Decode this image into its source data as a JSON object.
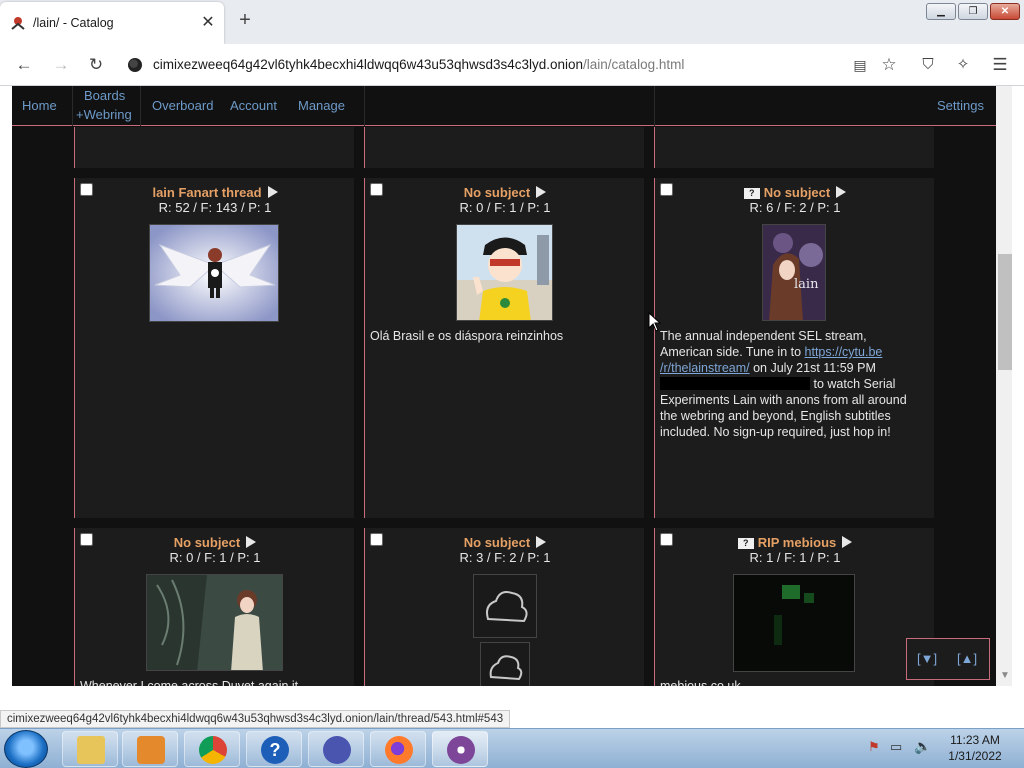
{
  "browser": {
    "tab_title": "/lain/ - Catalog",
    "tab_close": "✕",
    "new_tab": "+",
    "url_host": "cimixezweeq64g42vl6tyhk4becxhi4ldwqq6w43u53qhwsd3s4c3lyd.onion",
    "url_path": "/lain/catalog.html",
    "status_url": "cimixezweeq64g42vl6tyhk4becxhi4ldwqq6w43u53qhwsd3s4c3lyd.onion/lain/thread/543.html#543"
  },
  "site_nav": {
    "home": "Home",
    "boards": "Boards",
    "webring": "+Webring",
    "overboard": "Overboard",
    "account": "Account",
    "manage": "Manage",
    "settings": "Settings"
  },
  "threads": [
    {
      "title": "lain Fanart thread",
      "stats": "R: 52 / F: 143 / P: 1",
      "flag": ""
    },
    {
      "title": "No subject",
      "stats": "R: 0 / F: 1 / P: 1",
      "text": "Olá Brasil e os diáspora reinzinhos",
      "flag": ""
    },
    {
      "title": "No subject",
      "stats": "R: 6 / F: 2 / P: 1",
      "flag": "?",
      "text_a": "The annual independent SEL stream,",
      "text_b": "American side. Tune in to ",
      "link_a": "https://cytu.be",
      "link_b": "/r/thelainstream/",
      "text_c": " on July 21st 11:59 PM",
      "text_d": " to watch Serial",
      "text_e": "Experiments Lain with anons from all around",
      "text_f": "the webring and beyond, English subtitles",
      "text_g": "included. No sign-up required, just hop in!"
    },
    {
      "title": "No subject",
      "stats": "R: 0 / F: 1 / P: 1",
      "flag": "",
      "text": "Whenever I come across Duvet again it"
    },
    {
      "title": "No subject",
      "stats": "R: 3 / F: 2 / P: 1",
      "flag": ""
    },
    {
      "title": "RIP mebious",
      "stats": "R: 1 / F: 1 / P: 1",
      "flag": "?",
      "text": "mebious.co.uk"
    }
  ],
  "float_nav": {
    "down": "[▼]",
    "up": "[▲]"
  },
  "taskbar": {
    "time": "11:23 AM",
    "date": "1/31/2022"
  },
  "colors": {
    "accent": "#c86b7b",
    "title": "#e5a065",
    "link": "#7ea6d6",
    "bg": "#111111",
    "cell": "#1c1c1c"
  }
}
